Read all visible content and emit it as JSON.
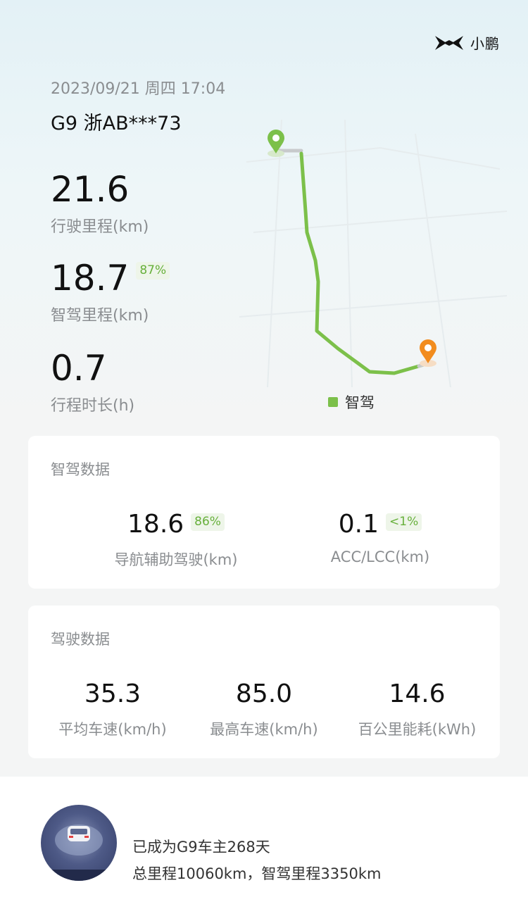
{
  "brand": {
    "logo_text": "小鹏"
  },
  "trip": {
    "datetime": "2023/09/21 周四 17:04",
    "vehicle_plate": "G9 浙AB***73"
  },
  "summary": {
    "distance": {
      "value": "21.6",
      "label": "行驶里程(km)"
    },
    "smart_drive": {
      "value": "18.7",
      "percent": "87%",
      "label": "智驾里程(km)"
    },
    "duration": {
      "value": "0.7",
      "label": "行程时长(h)"
    }
  },
  "map": {
    "legend_label": "智驾",
    "route_color": "#7cc04a",
    "start_color": "#7cc04a",
    "end_color": "#f28c1e"
  },
  "smart_drive_card": {
    "title": "智驾数据",
    "nav_assist": {
      "value": "18.6",
      "percent": "86%",
      "label": "导航辅助驾驶(km)"
    },
    "acc_lcc": {
      "value": "0.1",
      "percent": "<1%",
      "label": "ACC/LCC(km)"
    }
  },
  "driving_card": {
    "title": "驾驶数据",
    "avg_speed": {
      "value": "35.3",
      "label": "平均车速(km/h)"
    },
    "max_speed": {
      "value": "85.0",
      "label": "最高车速(km/h)"
    },
    "energy": {
      "value": "14.6",
      "label": "百公里能耗(kWh)"
    }
  },
  "owner": {
    "days_line": "已成为G9车主268天",
    "totals_line": "总里程10060km，智驾里程3350km"
  },
  "colors": {
    "accent_green": "#67b03b",
    "text_gray": "#8a8d90"
  }
}
